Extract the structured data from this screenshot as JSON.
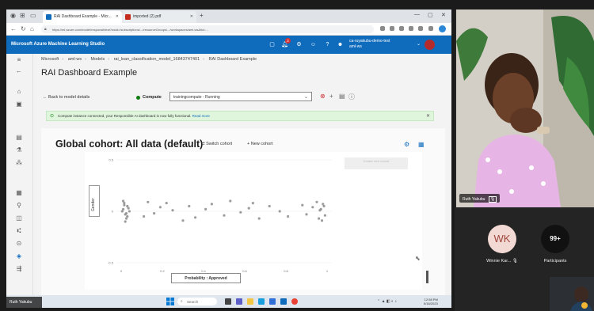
{
  "browser": {
    "tabs": [
      {
        "label": "RAI Dashboard Example - Micr...",
        "active": true
      },
      {
        "label": "imported (2).pdf",
        "active": false
      }
    ],
    "new_tab": "+",
    "url": "https://ml.azure.com/model/responsibleai?wsid=/subscriptions/.../resourceGroups/.../workspaces/aml-ws&tid=..."
  },
  "app": {
    "title": "Microsoft Azure Machine Learning Studio",
    "notifications_badge": "2",
    "account_line1": "ca-ruyakubu-demo-test",
    "account_line2": "aml-ws"
  },
  "breadcrumb": [
    "Microsoft",
    "aml-ws",
    "Models",
    "rai_loan_classification_model_16843747401",
    "RAI Dashboard Example"
  ],
  "page_title": "RAI Dashboard Example",
  "toolbar": {
    "back_label": "Back to model details",
    "compute_label": "Compute",
    "compute_value": "trainingcompute - Running"
  },
  "banner": {
    "text": "Compute instance connected, your Responsible AI dashboard is now fully functional.",
    "link": "Read more"
  },
  "dashboard": {
    "cohort_title": "Global cohort: All data (default)",
    "switch_cohort": "Switch cohort",
    "new_cohort": "New cohort",
    "faded_button": "Create new cohort"
  },
  "chart_data": {
    "type": "scatter",
    "ylabel": "Gender",
    "xlabel": "Probability : Approved",
    "xlim": [
      0,
      1
    ],
    "ylim": [
      -0.5,
      0.5
    ],
    "x_ticks": [
      "0",
      "0.2",
      "0.4",
      "0.6",
      "0.8",
      "1"
    ],
    "y_ticks": [
      "0.5",
      "0",
      "-0.5"
    ],
    "series": [
      {
        "x": [
          0.01,
          0.02,
          0.03,
          0.015,
          0.025,
          0.005,
          0.035,
          0.02,
          0.01,
          0.03,
          0.04,
          0.015,
          0.025,
          0.11,
          0.13,
          0.16,
          0.19,
          0.22,
          0.25,
          0.3,
          0.33,
          0.36,
          0.41,
          0.44,
          0.5,
          0.53,
          0.58,
          0.62,
          0.64,
          0.67,
          0.72,
          0.77,
          0.81,
          0.88,
          0.9,
          0.93,
          0.95,
          0.96,
          0.97,
          0.98,
          0.99,
          0.965,
          0.975,
          0.985
        ],
        "y": [
          0.02,
          -0.03,
          0.05,
          0.08,
          -0.07,
          0.0,
          0.03,
          -0.1,
          0.1,
          -0.05,
          0.0,
          0.06,
          -0.02,
          -0.05,
          0.09,
          -0.02,
          0.04,
          0.08,
          0.01,
          -0.09,
          0.05,
          -0.06,
          0.02,
          0.07,
          -0.04,
          0.1,
          -0.01,
          0.03,
          0.08,
          -0.07,
          0.05,
          0.0,
          -0.05,
          0.06,
          -0.03,
          0.04,
          0.09,
          -0.07,
          0.02,
          0.07,
          -0.04,
          0.01,
          -0.09,
          0.05
        ]
      }
    ]
  },
  "taskbar": {
    "search": "Search",
    "time": "12:58 PM",
    "date": "5/16/2023"
  },
  "presenter_tag": "Ruth Yakubu",
  "meeting": {
    "video_name": "Ruth Yakubu",
    "participant_initials": "WK",
    "participant_name": "Winnie Kar...",
    "participants_count": "99+",
    "participants_label": "Participants"
  }
}
